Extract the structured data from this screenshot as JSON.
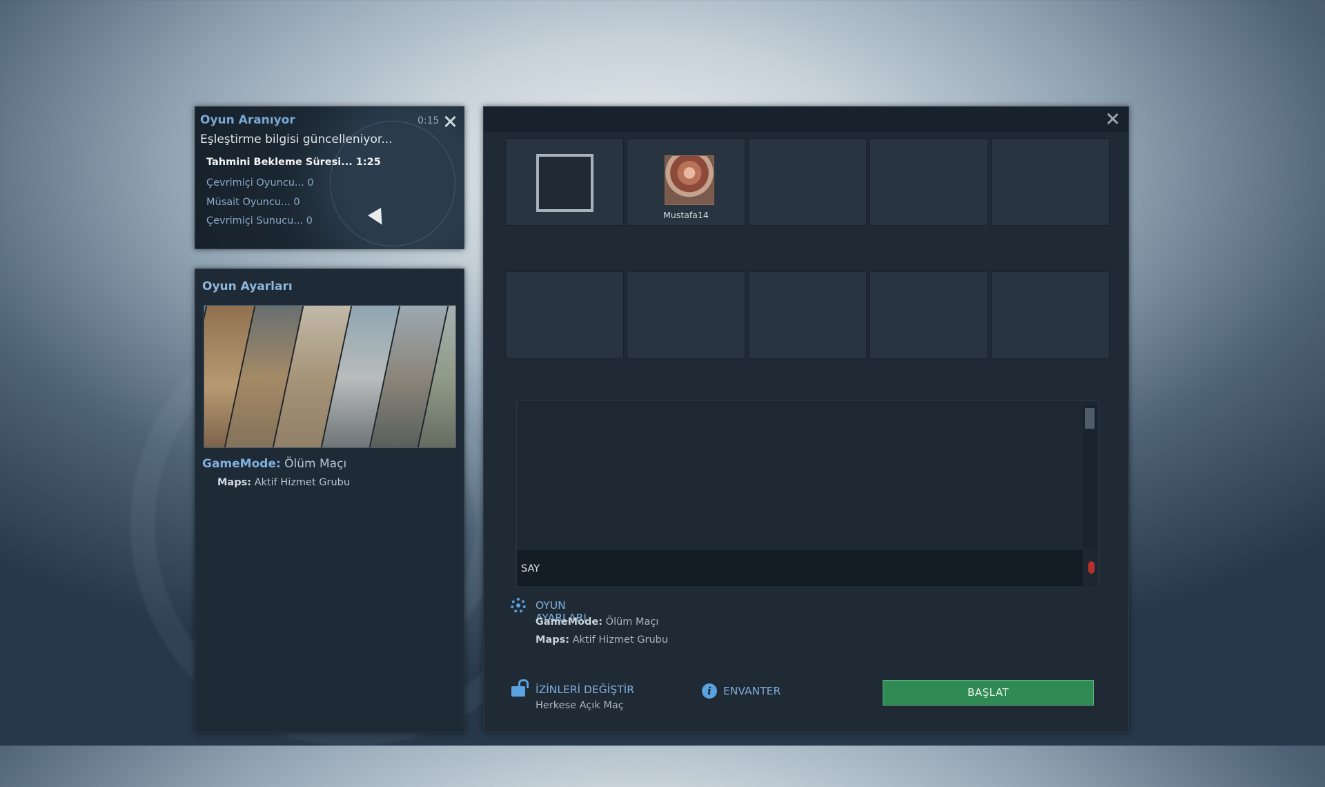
{
  "search": {
    "title": "Oyun Aranıyor",
    "timer": "0:15",
    "status": "Eşleştirme bilgisi güncelleniyor...",
    "wait_time": "Tahmini Bekleme Süresi... 1:25",
    "online_players": "Çevrimiçi Oyuncu... 0",
    "available_players": "Müsait Oyuncu... 0",
    "online_servers": "Çevrimiçi Sunucu... 0"
  },
  "settings_panel": {
    "title": "Oyun Ayarları",
    "gamemode_key": "GameMode:",
    "gamemode_value": "Ölüm Maçı",
    "maps_key": "Maps:",
    "maps_value": "Aktif Hizmet Grubu"
  },
  "lobby": {
    "players": [
      "",
      "Mustafa14",
      "",
      "",
      "",
      "",
      "",
      "",
      "",
      ""
    ],
    "chat": {
      "input_label": "SAY"
    },
    "game_settings": {
      "title": "OYUN AYARLARI",
      "gamemode_key": "GameMode:",
      "gamemode_value": "Ölüm Maçı",
      "maps_key": "Maps:",
      "maps_value": "Aktif Hizmet Grubu"
    },
    "permissions": {
      "title": "İZİNLERİ DEĞİŞTİR",
      "subtitle": "Herkese Açık Maç"
    },
    "inventory": {
      "title": "ENVANTER"
    },
    "start_label": "BAŞLAT"
  },
  "colors": {
    "accent": "#5aa2e0",
    "start": "#2f8a53",
    "panel": "#1f2a35"
  },
  "icons": [
    "close-icon",
    "gear-icon",
    "lock-icon",
    "info-icon",
    "mic-icon",
    "cursor-icon"
  ]
}
